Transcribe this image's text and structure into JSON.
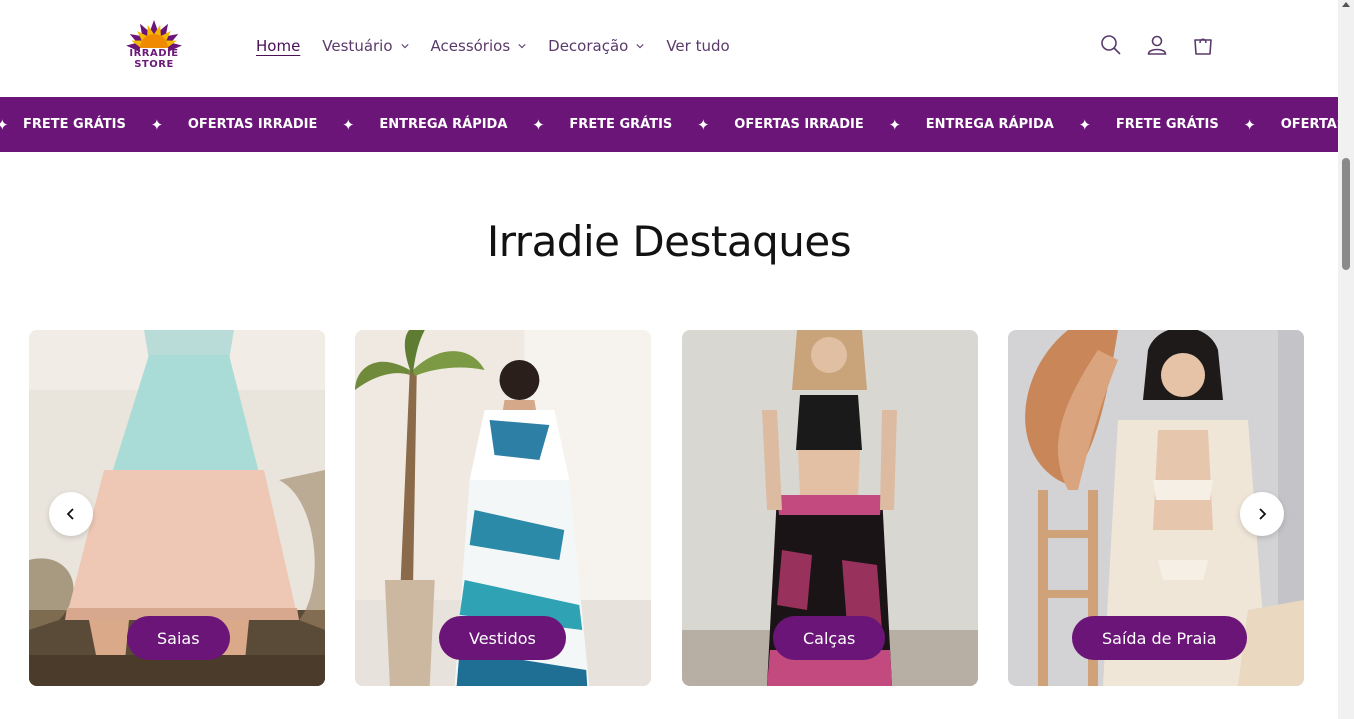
{
  "brand": {
    "logo_text_line1": "IRRADIE",
    "logo_text_line2": "STORE",
    "primary_color": "#6b1578",
    "accent_color": "#f5b800"
  },
  "nav": {
    "items": [
      {
        "label": "Home",
        "active": true,
        "has_dropdown": false
      },
      {
        "label": "Vestuário",
        "active": false,
        "has_dropdown": true
      },
      {
        "label": "Acessórios",
        "active": false,
        "has_dropdown": true
      },
      {
        "label": "Decoração",
        "active": false,
        "has_dropdown": true
      },
      {
        "label": "Ver tudo",
        "active": false,
        "has_dropdown": false
      }
    ]
  },
  "header_icons": [
    "search-icon",
    "account-icon",
    "cart-icon"
  ],
  "marquee": {
    "items": [
      "FRETE GRÁTIS",
      "OFERTAS IRRADIE",
      "ENTREGA RÁPIDA",
      "FRETE GRÁTIS",
      "OFERTAS IRRADIE",
      "ENTREGA RÁPIDA",
      "FRETE GRÁTIS",
      "OFERTAS IRRADIE"
    ],
    "separator": "✦"
  },
  "section": {
    "title": "Irradie Destaques"
  },
  "cards": [
    {
      "label": "Saias"
    },
    {
      "label": "Vestidos"
    },
    {
      "label": "Calças"
    },
    {
      "label": "Saída de Praia"
    }
  ]
}
